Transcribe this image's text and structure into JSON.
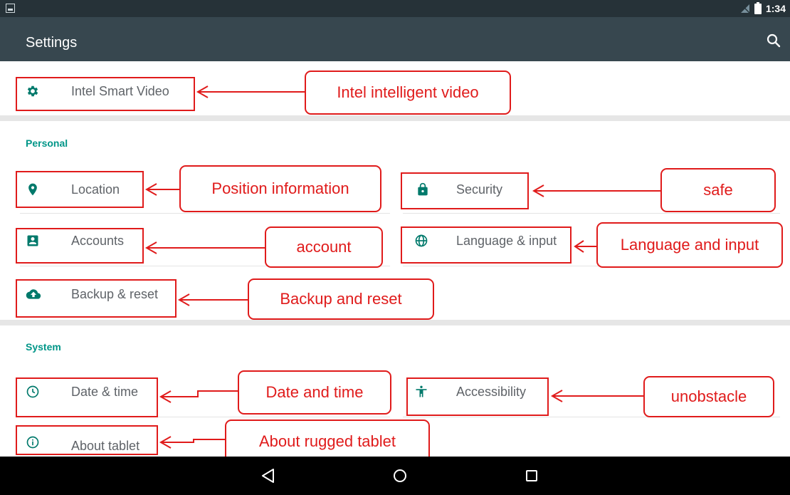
{
  "status_bar": {
    "time": "1:34"
  },
  "toolbar": {
    "title": "Settings"
  },
  "sections": {
    "personal": "Personal",
    "system": "System"
  },
  "items": {
    "intel_video": "Intel Smart Video",
    "location": "Location",
    "security": "Security",
    "accounts": "Accounts",
    "language": "Language & input",
    "backup": "Backup & reset",
    "date_time": "Date & time",
    "accessibility": "Accessibility",
    "about": "About tablet"
  },
  "annotations": {
    "intel_video": "Intel intelligent video",
    "location": "Position information",
    "security": "safe",
    "accounts": "account",
    "language": "Language and input",
    "backup": "Backup and reset",
    "date_time": "Date and time",
    "accessibility": "unobstacle",
    "about": "About rugged tablet"
  },
  "colors": {
    "toolbar": "#37474f",
    "status_bar": "#263238",
    "accent": "#009688",
    "annotation": "#e01b1b"
  }
}
